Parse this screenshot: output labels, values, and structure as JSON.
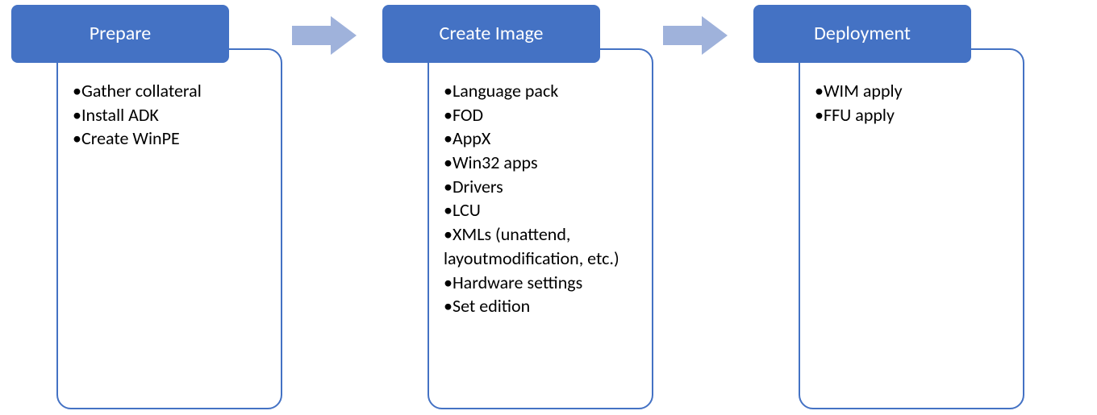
{
  "accent_color": "#4472C4",
  "cap_color": "#D6DCE5",
  "arrow_color": "#9FB2DB",
  "stages": [
    {
      "title": "Prepare",
      "items": [
        "Gather collateral",
        "Install ADK",
        "Create WinPE"
      ]
    },
    {
      "title": "Create Image",
      "items": [
        "Language pack",
        "FOD",
        "AppX",
        "Win32 apps",
        "Drivers",
        "LCU",
        "XMLs (unattend, layoutmodification, etc.)",
        "Hardware settings",
        "Set edition"
      ]
    },
    {
      "title": "Deployment",
      "items": [
        "WIM apply",
        "FFU apply"
      ]
    }
  ]
}
